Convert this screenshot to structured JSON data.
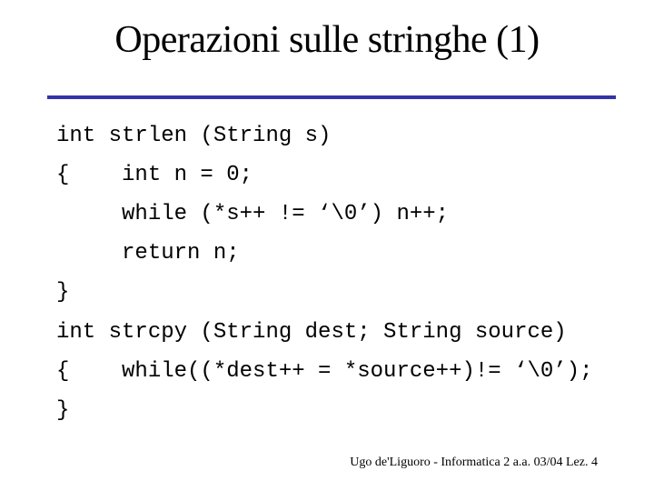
{
  "slide": {
    "title": "Operazioni sulle stringhe (1)",
    "code_lines": [
      "int strlen (String s)",
      "{    int n = 0;",
      "     while (*s++ != ‘\\0’) n++;",
      "     return n;",
      "}",
      "int strcpy (String dest; String source)",
      "{    while((*dest++ = *source++)!= ‘\\0’);",
      "}"
    ],
    "footer": "Ugo de'Liguoro - Informatica 2 a.a. 03/04 Lez. 4",
    "accent_color": "#3333aa"
  }
}
